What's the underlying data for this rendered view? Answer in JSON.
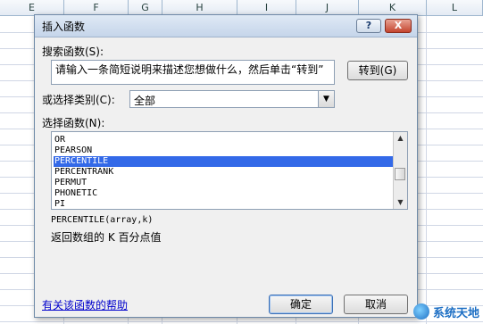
{
  "sheet": {
    "columns": [
      "E",
      "F",
      "G",
      "H",
      "I",
      "J",
      "K",
      "L"
    ]
  },
  "dialog": {
    "title": "插入函数",
    "help_button": "?",
    "close_button": "X",
    "search_label": "搜索函数(S):",
    "search_value": "请输入一条简短说明来描述您想做什么，然后单击“转到”",
    "goto_button": "转到(G)",
    "category_label": "或选择类别(C):",
    "category_value": "全部",
    "function_label": "选择函数(N):",
    "functions": [
      "OR",
      "PEARSON",
      "PERCENTILE",
      "PERCENTRANK",
      "PERMUT",
      "PHONETIC",
      "PI"
    ],
    "selected_function": "PERCENTILE",
    "signature": "PERCENTILE(array,k)",
    "description": "返回数组的 K 百分点值",
    "help_link": "有关该函数的帮助",
    "ok_button": "确定",
    "cancel_button": "取消"
  },
  "watermark": {
    "text": "系统天地"
  },
  "colors": {
    "selection": "#3369e8",
    "link": "#0000cc",
    "titlebar": "#c5d5ea"
  }
}
